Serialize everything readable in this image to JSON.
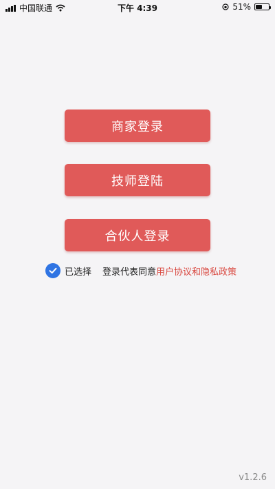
{
  "status_bar": {
    "carrier": "中国联通",
    "time": "下午 4:39",
    "battery_text": "51%",
    "battery_level": 0.51,
    "icons": [
      "signal-icon",
      "wifi-icon",
      "orientation-lock-icon",
      "battery-icon"
    ]
  },
  "login": {
    "merchant_label": "商家登录",
    "technician_label": "技师登陆",
    "partner_label": "合伙人登录",
    "button_color": "#e05a59"
  },
  "agreement": {
    "checked": true,
    "selected_label": "已选择",
    "prefix": "登录代表同意",
    "link_text": "用户协议和隐私政策",
    "check_color": "#2f74e3",
    "link_color": "#d9473f"
  },
  "version": "v1.2.6"
}
